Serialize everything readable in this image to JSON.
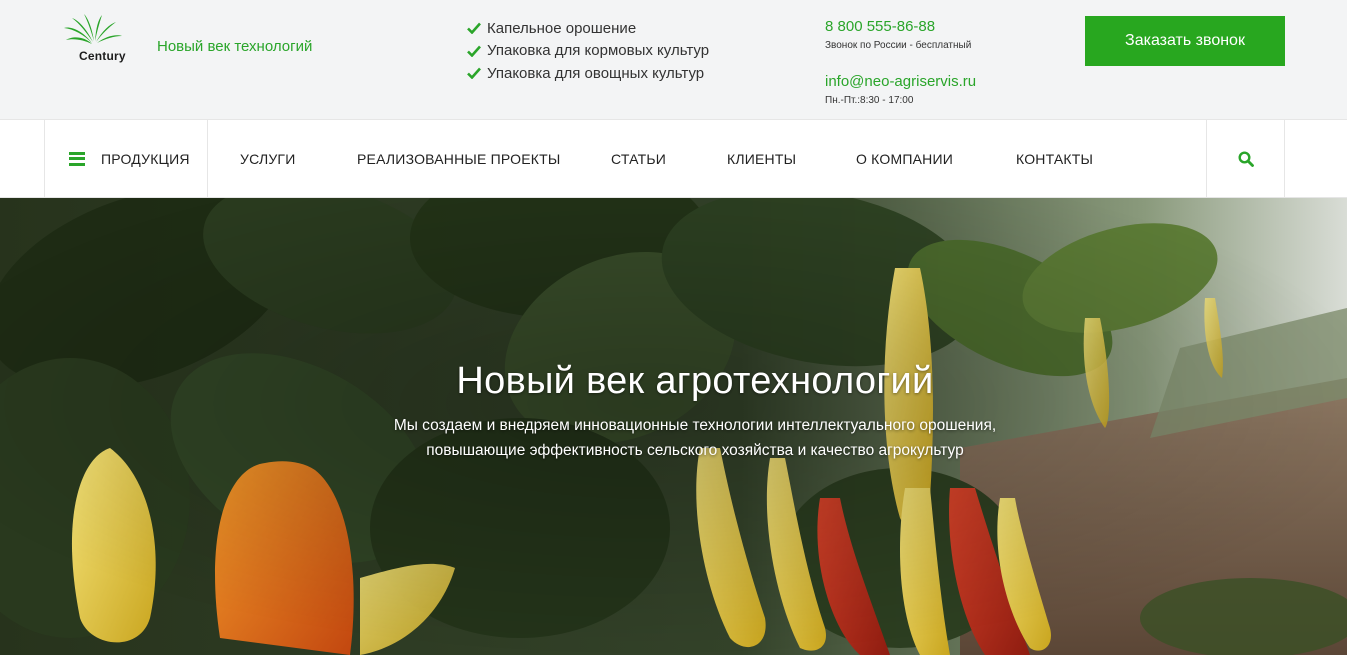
{
  "brand": {
    "logo_text": "Century",
    "tagline": "Новый век технологий",
    "accent_color": "#28a71f"
  },
  "features": [
    "Капельное орошение",
    "Упаковка для кормовых культур",
    "Упаковка для овощных культур"
  ],
  "contacts": {
    "phone": "8 800 555-86-88",
    "phone_note": "Звонок по России - бесплатный",
    "email": "info@neo-agriservis.ru",
    "hours": "Пн.-Пт.:8:30 - 17:00"
  },
  "cta": {
    "label": "Заказать звонок"
  },
  "nav": {
    "products": "ПРОДУКЦИЯ",
    "items": [
      "УСЛУГИ",
      "РЕАЛИЗОВАННЫЕ ПРОЕКТЫ",
      "СТАТЬИ",
      "КЛИЕНТЫ",
      "О КОМПАНИИ",
      "КОНТАКТЫ"
    ],
    "search_icon": "search-icon",
    "menu_icon": "hamburger-icon"
  },
  "hero": {
    "title": "Новый век агротехнологий",
    "subtitle_line1": "Мы создаем и внедряем инновационные технологии интеллектуального орошения,",
    "subtitle_line2": "повышающие эффективность сельского хозяйства и качество агрокультур"
  }
}
